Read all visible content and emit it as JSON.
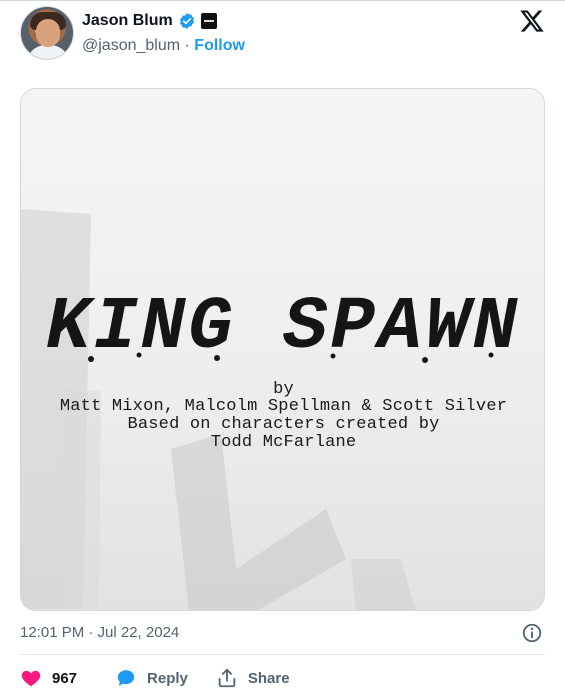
{
  "author": {
    "name": "Jason Blum",
    "handle": "@jason_blum",
    "separator": " · ",
    "follow_label": "Follow"
  },
  "icons": {
    "verified": "verified-badge-icon",
    "affiliate": "blumhouse-affiliate-icon",
    "platform": "x-logo-icon",
    "info": "info-icon",
    "like": "heart-icon",
    "reply": "speech-bubble-icon",
    "share": "share-upload-icon"
  },
  "media": {
    "title": "KING SPAWN",
    "credits": [
      "by",
      "Matt Mixon, Malcolm Spellman & Scott Silver",
      "Based on characters created by",
      "Todd McFarlane"
    ]
  },
  "timestamp": "12:01 PM · Jul 22, 2024",
  "actions": {
    "likes": "967",
    "reply_label": "Reply",
    "share_label": "Share"
  },
  "colors": {
    "accent": "#1d9bf0",
    "like": "#f91880",
    "text": "#0f1419",
    "muted": "#536471"
  }
}
